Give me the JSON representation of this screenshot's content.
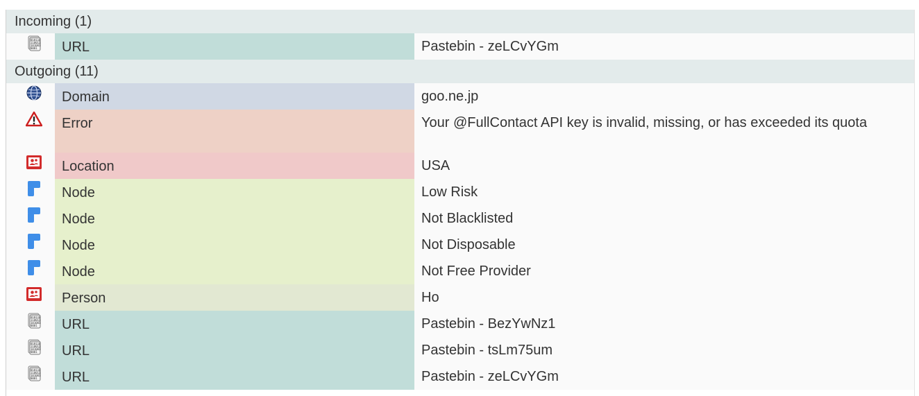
{
  "incoming": {
    "header": "Incoming (1)",
    "rows": [
      {
        "icon": "binary-document-icon",
        "type": "URL",
        "value": "Pastebin - zeLCvYGm",
        "color": "#c1ddd9"
      }
    ]
  },
  "outgoing": {
    "header": "Outgoing (11)",
    "rows": [
      {
        "icon": "globe-icon",
        "type": "Domain",
        "value": "goo.ne.jp",
        "color": "#d0d8e4"
      },
      {
        "icon": "warning-icon",
        "type": "Error",
        "value": "Your @FullContact API key is invalid, missing, or has exceeded its quota",
        "color": "#eed1c6"
      },
      {
        "icon": "person-card-icon",
        "type": "Location",
        "value": "USA",
        "color": "#f0c9c9"
      },
      {
        "icon": "node-icon",
        "type": "Node",
        "value": "Low Risk",
        "color": "#e6f0cc"
      },
      {
        "icon": "node-icon",
        "type": "Node",
        "value": "Not Blacklisted",
        "color": "#e6f0cc"
      },
      {
        "icon": "node-icon",
        "type": "Node",
        "value": "Not Disposable",
        "color": "#e6f0cc"
      },
      {
        "icon": "node-icon",
        "type": "Node",
        "value": "Not Free Provider",
        "color": "#e6f0cc"
      },
      {
        "icon": "person-card-icon",
        "type": "Person",
        "value": "Ho",
        "color": "#e2e8d2"
      },
      {
        "icon": "binary-document-icon",
        "type": "URL",
        "value": "Pastebin - BezYwNz1",
        "color": "#c1ddd9"
      },
      {
        "icon": "binary-document-icon",
        "type": "URL",
        "value": "Pastebin - tsLm75um",
        "color": "#c1ddd9"
      },
      {
        "icon": "binary-document-icon",
        "type": "URL",
        "value": "Pastebin - zeLCvYGm",
        "color": "#c1ddd9"
      }
    ]
  }
}
